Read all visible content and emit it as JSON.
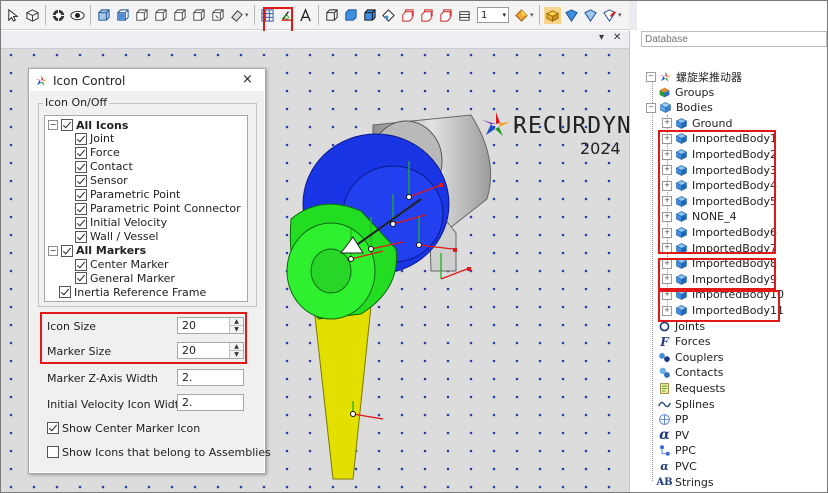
{
  "toolbar": {
    "zoom_value": "1"
  },
  "document_bar": {
    "pin": "▾",
    "close": "✕"
  },
  "viewport": {
    "logo_text": "RECURDYN",
    "logo_year": "2024"
  },
  "database": {
    "placeholder": "Database",
    "items": [
      {
        "label": "螺旋桨推动器",
        "icon": "model-star-icon"
      },
      {
        "label": "Groups",
        "icon": "groups-icon"
      },
      {
        "label": "Bodies",
        "icon": "bodies-icon"
      },
      {
        "label": "Ground",
        "icon": "body-icon"
      },
      {
        "label": "ImportedBody1",
        "icon": "body-icon"
      },
      {
        "label": "ImportedBody2",
        "icon": "body-icon"
      },
      {
        "label": "ImportedBody3",
        "icon": "body-icon"
      },
      {
        "label": "ImportedBody4",
        "icon": "body-icon"
      },
      {
        "label": "ImportedBody5",
        "icon": "body-icon"
      },
      {
        "label": "NONE_4",
        "icon": "body-icon"
      },
      {
        "label": "ImportedBody6",
        "icon": "body-icon"
      },
      {
        "label": "ImportedBody7",
        "icon": "body-icon"
      },
      {
        "label": "ImportedBody8",
        "icon": "body-icon"
      },
      {
        "label": "ImportedBody9",
        "icon": "body-icon"
      },
      {
        "label": "ImportedBody10",
        "icon": "body-icon"
      },
      {
        "label": "ImportedBody11",
        "icon": "body-icon"
      },
      {
        "label": "Joints",
        "icon": "joints-icon"
      },
      {
        "label": "Forces",
        "icon": "forces-icon"
      },
      {
        "label": "Couplers",
        "icon": "couplers-icon"
      },
      {
        "label": "Contacts",
        "icon": "contacts-icon"
      },
      {
        "label": "Requests",
        "icon": "requests-icon"
      },
      {
        "label": "Splines",
        "icon": "splines-icon"
      },
      {
        "label": "PP",
        "icon": "pp-icon"
      },
      {
        "label": "PV",
        "icon": "pv-icon"
      },
      {
        "label": "PPC",
        "icon": "ppc-icon"
      },
      {
        "label": "PVC",
        "icon": "pvc-icon"
      },
      {
        "label": "Strings",
        "icon": "strings-icon"
      }
    ]
  },
  "dialog": {
    "title": "Icon Control",
    "close": "×",
    "group_label": "Icon On/Off",
    "tree": [
      {
        "label": "All Icons",
        "checked": true,
        "bold": true
      },
      {
        "label": "Joint",
        "checked": true
      },
      {
        "label": "Force",
        "checked": true
      },
      {
        "label": "Contact",
        "checked": true
      },
      {
        "label": "Sensor",
        "checked": true
      },
      {
        "label": "Parametric Point",
        "checked": true
      },
      {
        "label": "Parametric Point Connector",
        "checked": true
      },
      {
        "label": "Initial Velocity",
        "checked": true
      },
      {
        "label": "Wall / Vessel",
        "checked": true
      },
      {
        "label": "All Markers",
        "checked": true,
        "bold": true
      },
      {
        "label": "Center Marker",
        "checked": true
      },
      {
        "label": "General Marker",
        "checked": true
      },
      {
        "label": "Inertia Reference Frame",
        "checked": true
      }
    ],
    "icon_size_label": "Icon Size",
    "icon_size_value": "20",
    "marker_size_label": "Marker Size",
    "marker_size_value": "20",
    "marker_z_label": "Marker Z-Axis Width",
    "marker_z_value": "2.",
    "init_vel_label": "Initial Velocity Icon Width",
    "init_vel_value": "2.",
    "show_center_label": "Show Center Marker Icon",
    "show_center_checked": true,
    "show_assemblies_label": "Show Icons that belong to Assemblies",
    "show_assemblies_checked": false
  },
  "colors": {
    "highlight": "#e01818",
    "green_body": "#22dd22",
    "blue_body": "#1a35e6",
    "yellow_body": "#e3e000"
  }
}
